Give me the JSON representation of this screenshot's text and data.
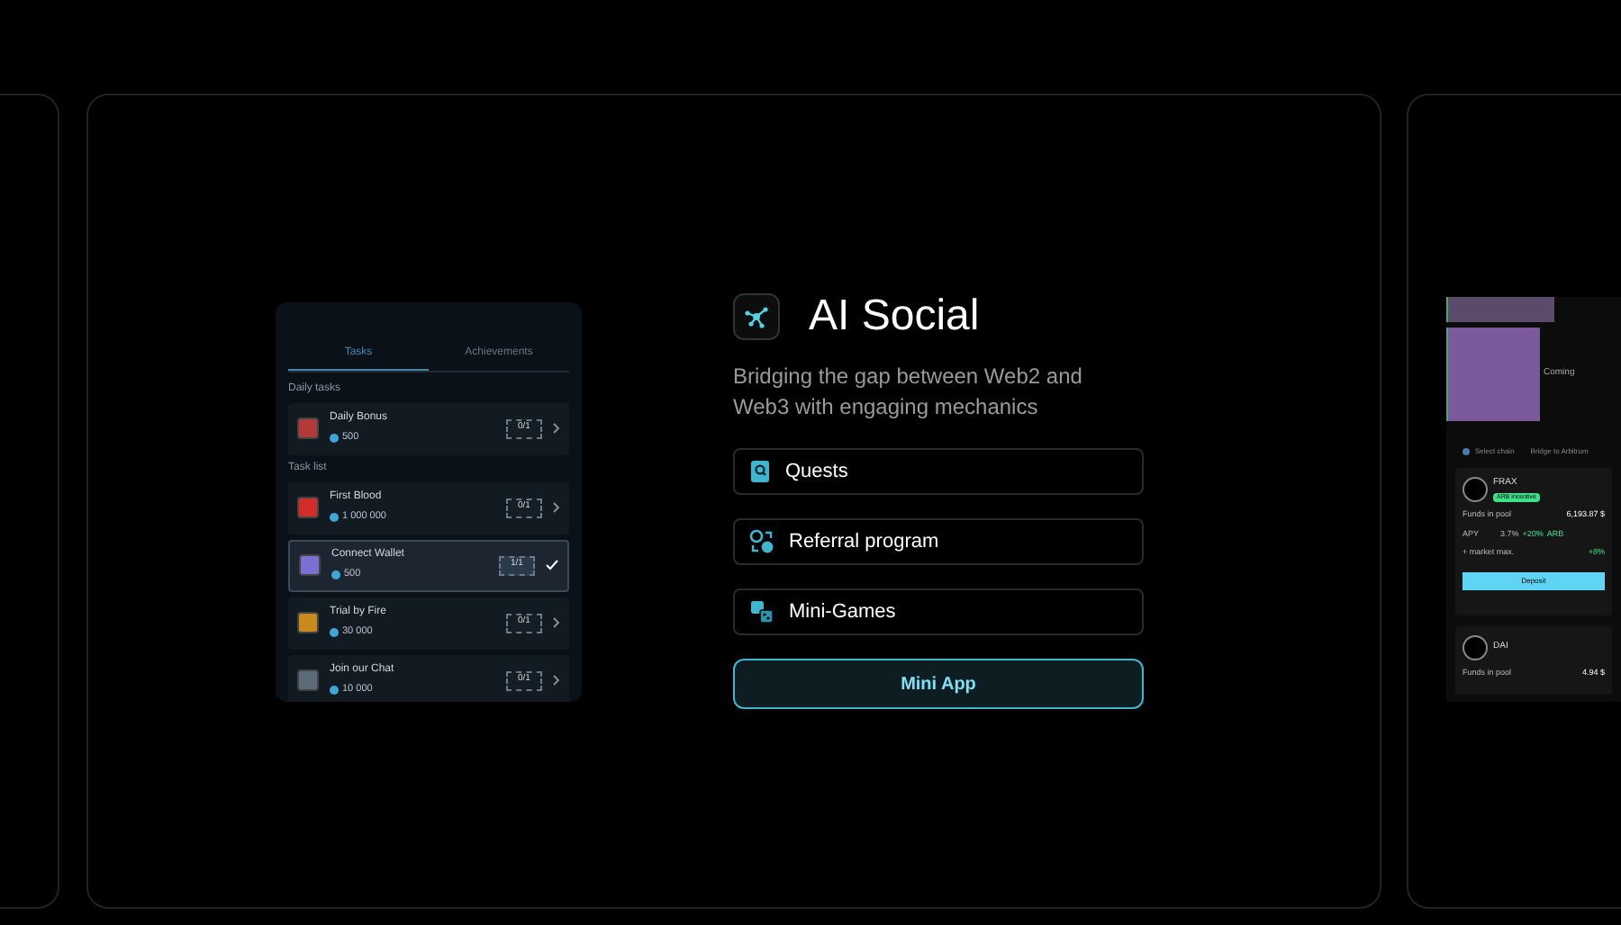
{
  "feature": {
    "title": "AI Social",
    "description": "Bridging the gap between Web2 and Web3 with engaging mechanics",
    "items": [
      {
        "label": "Quests",
        "kind": "quests"
      },
      {
        "label": "Referral program",
        "kind": "referral"
      },
      {
        "label": "Mini-Games",
        "kind": "games"
      }
    ],
    "button": "Mini App"
  },
  "tasks_preview": {
    "tabs": [
      {
        "label": "Tasks",
        "selected": true
      },
      {
        "label": "Achievements",
        "selected": false
      }
    ],
    "sections": [
      {
        "title": "Daily tasks",
        "tasks": [
          {
            "name": "Daily Bonus",
            "reward": "500",
            "progress": "0/1",
            "done": false,
            "selected": false,
            "color": "#b23a3a"
          }
        ]
      },
      {
        "title": "Task list",
        "tasks": [
          {
            "name": "First Blood",
            "reward": "1 000 000",
            "progress": "0/1",
            "done": false,
            "selected": false,
            "color": "#d42b2b"
          },
          {
            "name": "Connect Wallet",
            "reward": "500",
            "progress": "1/1",
            "done": true,
            "selected": true,
            "color": "#7b6fd6"
          },
          {
            "name": "Trial by Fire",
            "reward": "30 000",
            "progress": "0/1",
            "done": false,
            "selected": false,
            "color": "#c98a1e"
          },
          {
            "name": "Join our Chat",
            "reward": "10 000",
            "progress": "0/1",
            "done": false,
            "selected": false,
            "color": "#5b6b7a"
          }
        ]
      }
    ]
  },
  "pools_preview": {
    "banner_text": "Coming",
    "chain_select": "Select chain",
    "bridge_link": "Bridge to Arbitrum",
    "pools": [
      {
        "name": "FRAX",
        "badge": "ARB incentive",
        "funds_label": "Funds in pool",
        "funds": "6,193.87 $",
        "apy_label": "APY",
        "apy": "3.7%",
        "boost": "+20%",
        "boost_token": "ARB",
        "extra_label": "+ market max.",
        "extra": "+8%",
        "button": "Deposit"
      },
      {
        "name": "DAI",
        "funds_label": "Funds in pool",
        "funds": "4.94 $"
      }
    ]
  }
}
